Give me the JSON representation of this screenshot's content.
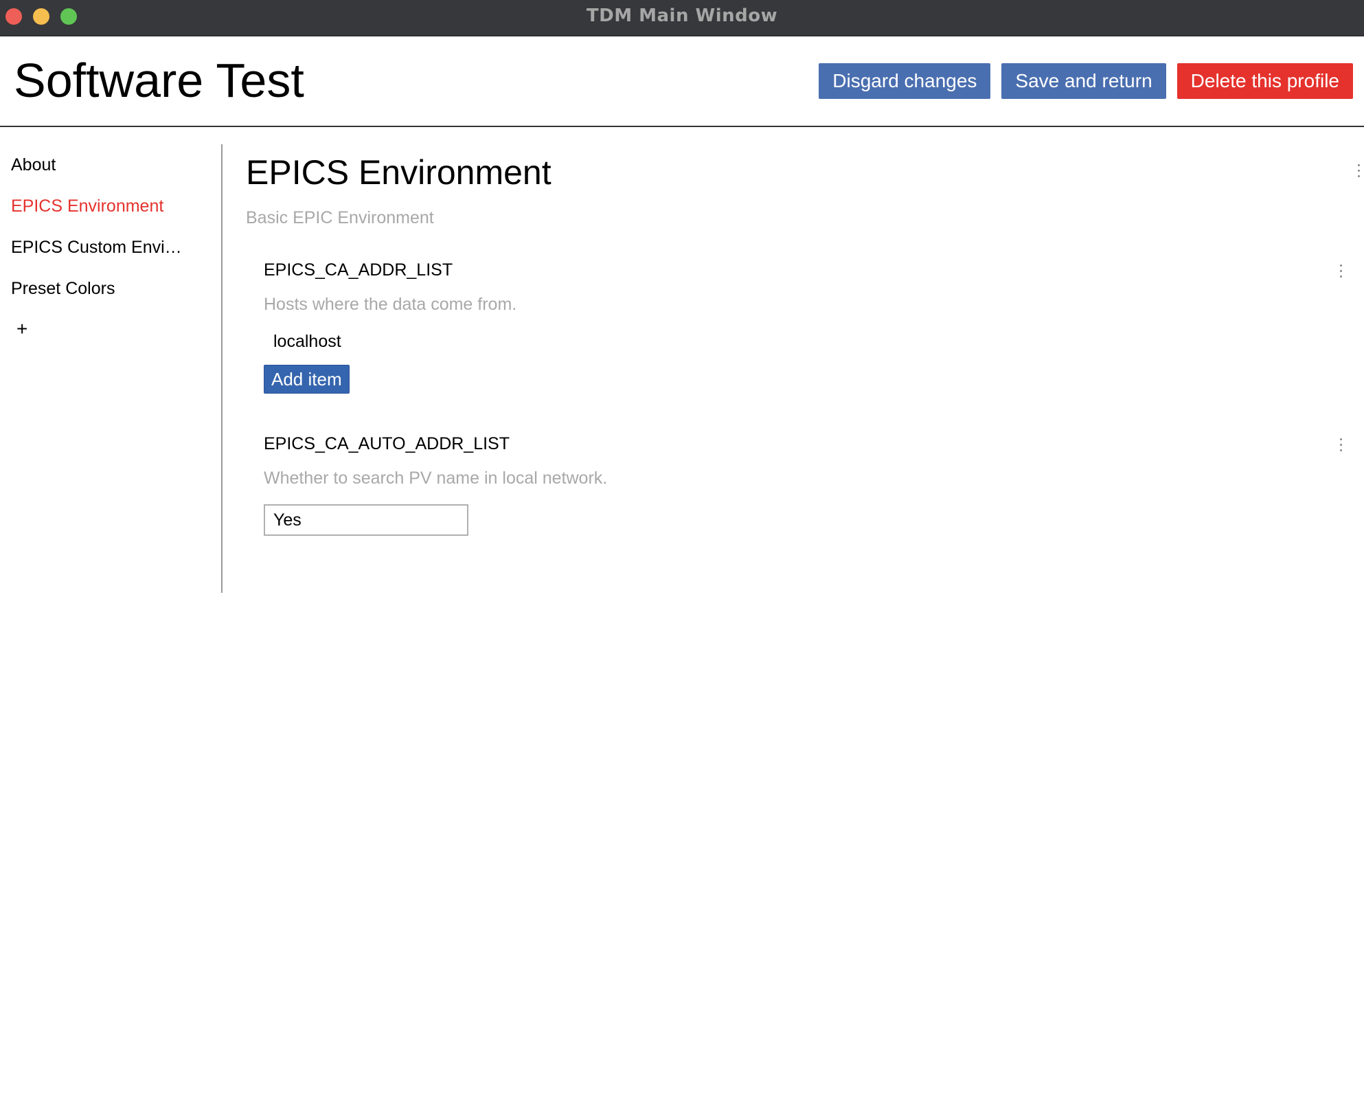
{
  "window": {
    "title": "TDM Main Window"
  },
  "header": {
    "profile_name": "Software Test",
    "discard_label": "Disgard changes",
    "save_label": "Save and return",
    "delete_label": "Delete this profile"
  },
  "sidebar": {
    "items": [
      {
        "label": "About"
      },
      {
        "label": "EPICS Environment"
      },
      {
        "label": "EPICS Custom Envi…"
      },
      {
        "label": "Preset Colors"
      }
    ],
    "add_label": "+"
  },
  "main": {
    "section_title": "EPICS Environment",
    "section_description": "Basic EPIC Environment",
    "fields": [
      {
        "name": "EPICS_CA_ADDR_LIST",
        "description": "Hosts where the data come from.",
        "values": [
          "localhost"
        ],
        "add_item_label": "Add item"
      },
      {
        "name": "EPICS_CA_AUTO_ADDR_LIST",
        "description": "Whether to search PV name in local network.",
        "selected": "Yes"
      }
    ]
  },
  "colors": {
    "accent_blue": "#4a6fb0",
    "danger_red": "#e5322d",
    "active_nav": "#e5322d"
  }
}
